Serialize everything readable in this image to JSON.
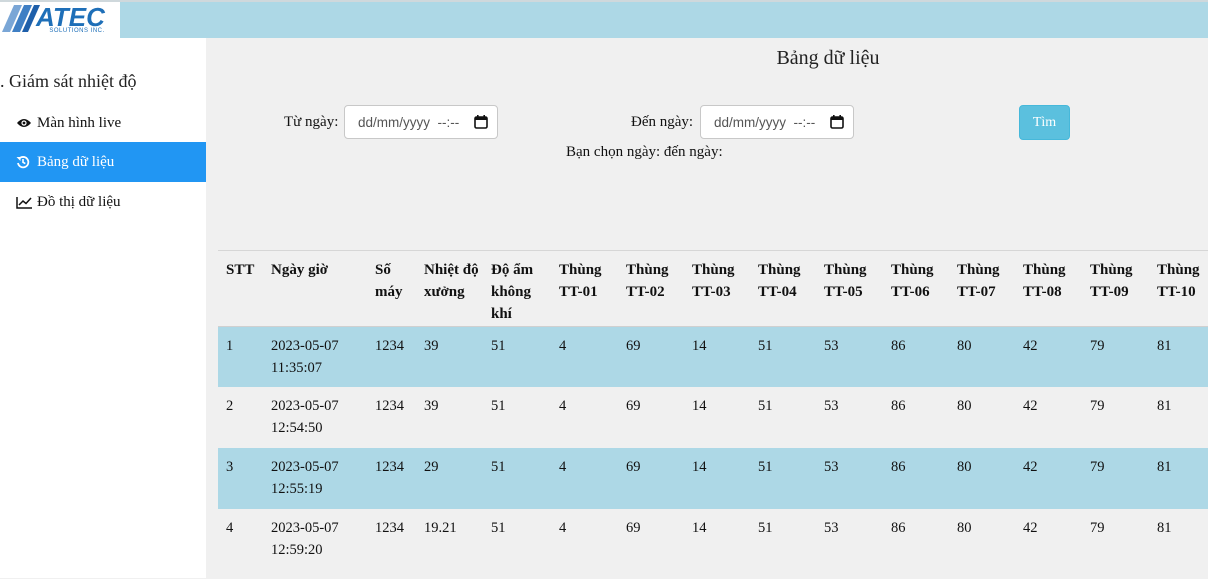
{
  "logo": {
    "text": "ATEC",
    "sub": "SOLUTIONS INC."
  },
  "sidebar": {
    "title": ". Giám sát nhiệt độ",
    "items": [
      {
        "label": "Màn hình live",
        "icon": "eye-icon",
        "active": false
      },
      {
        "label": "Bảng dữ liệu",
        "icon": "history-icon",
        "active": true
      },
      {
        "label": "Đồ thị dữ liệu",
        "icon": "line-chart-icon",
        "active": false
      }
    ]
  },
  "main": {
    "title": "Bảng dữ liệu",
    "from_label": "Từ ngày:",
    "to_label": "Đến ngày:",
    "from_value": "dd/mm/yyyy  --:--",
    "to_value": "dd/mm/yyyy  --:--",
    "search_label": "Tìm",
    "selected_text": "Bạn chọn ngày: đến ngày:"
  },
  "table": {
    "headers": [
      "STT",
      "Ngày giờ",
      "Số máy",
      "Nhiệt độ xưởng",
      "Độ ẩm không khí",
      "Thùng TT-01",
      "Thùng TT-02",
      "Thùng TT-03",
      "Thùng TT-04",
      "Thùng TT-05",
      "Thùng TT-06",
      "Thùng TT-07",
      "Thùng TT-08",
      "Thùng TT-09",
      "Thùng TT-10"
    ],
    "rows": [
      [
        "1",
        "2023-05-07 11:35:07",
        "1234",
        "39",
        "51",
        "4",
        "69",
        "14",
        "51",
        "53",
        "86",
        "80",
        "42",
        "79",
        "81"
      ],
      [
        "2",
        "2023-05-07 12:54:50",
        "1234",
        "39",
        "51",
        "4",
        "69",
        "14",
        "51",
        "53",
        "86",
        "80",
        "42",
        "79",
        "81"
      ],
      [
        "3",
        "2023-05-07 12:55:19",
        "1234",
        "29",
        "51",
        "4",
        "69",
        "14",
        "51",
        "53",
        "86",
        "80",
        "42",
        "79",
        "81"
      ],
      [
        "4",
        "2023-05-07 12:59:20",
        "1234",
        "19.21",
        "51",
        "4",
        "69",
        "14",
        "51",
        "53",
        "86",
        "80",
        "42",
        "79",
        "81"
      ]
    ]
  },
  "colors": {
    "topbar": "#add8e6",
    "active_nav": "#2196f3",
    "row_highlight": "#add8e6",
    "button": "#5bc0de"
  }
}
